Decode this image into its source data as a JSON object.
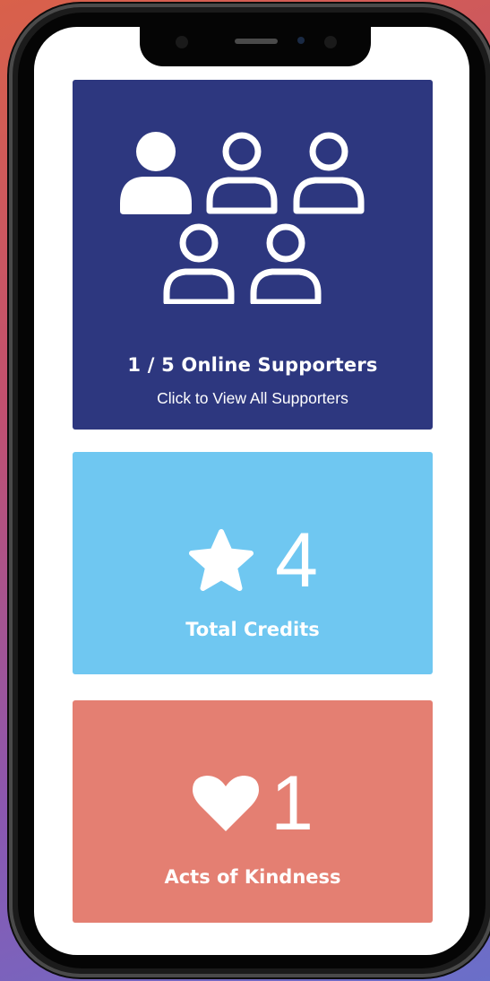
{
  "supporters": {
    "online_count_label": "1 / 5 Online Supporters",
    "link_label": "Click to View All Supporters",
    "icons": [
      "user-filled-icon",
      "user-outline-icon",
      "user-outline-icon",
      "user-outline-icon",
      "user-outline-icon"
    ],
    "online": 1,
    "total": 5,
    "background": "#2d377f"
  },
  "credits": {
    "value": "4",
    "label": "Total Credits",
    "icon": "star-icon",
    "background": "#6fc7f1"
  },
  "kindness": {
    "value": "1",
    "label": "Acts of Kindness",
    "icon": "heart-icon",
    "background": "#e47f72"
  }
}
